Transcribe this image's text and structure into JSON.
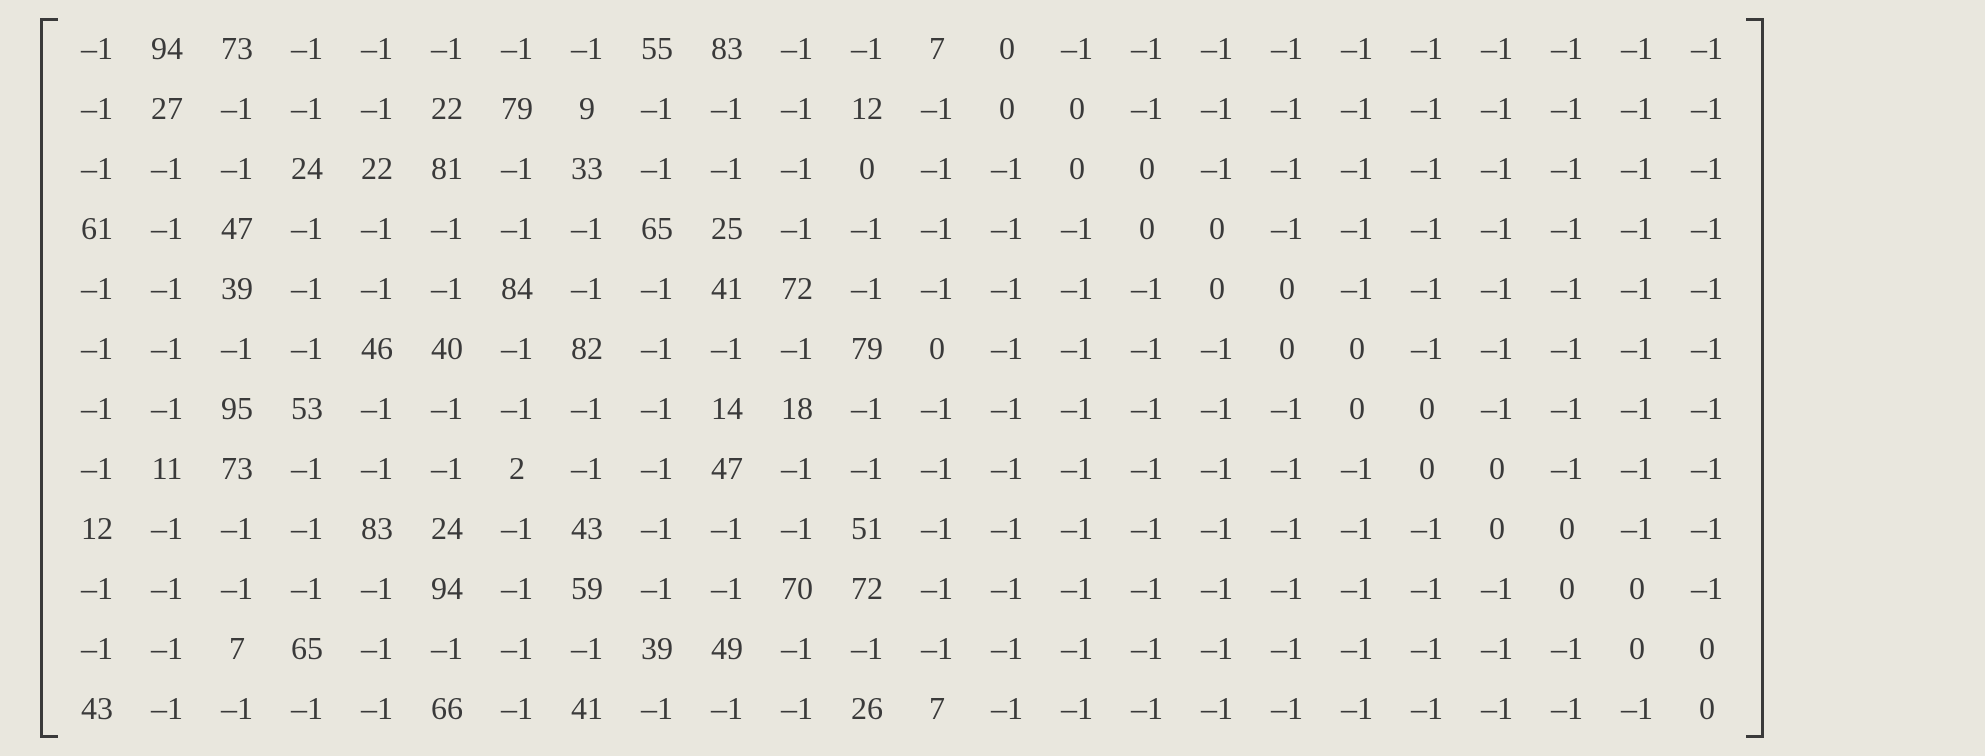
{
  "chart_data": {
    "type": "table",
    "title": "",
    "rows": 12,
    "cols": 24,
    "values": [
      [
        -1,
        94,
        73,
        -1,
        -1,
        -1,
        -1,
        -1,
        55,
        83,
        -1,
        -1,
        7,
        0,
        -1,
        -1,
        -1,
        -1,
        -1,
        -1,
        -1,
        -1,
        -1,
        -1
      ],
      [
        -1,
        27,
        -1,
        -1,
        -1,
        22,
        79,
        9,
        -1,
        -1,
        -1,
        12,
        -1,
        0,
        0,
        -1,
        -1,
        -1,
        -1,
        -1,
        -1,
        -1,
        -1,
        -1
      ],
      [
        -1,
        -1,
        -1,
        24,
        22,
        81,
        -1,
        33,
        -1,
        -1,
        -1,
        0,
        -1,
        -1,
        0,
        0,
        -1,
        -1,
        -1,
        -1,
        -1,
        -1,
        -1,
        -1
      ],
      [
        61,
        -1,
        47,
        -1,
        -1,
        -1,
        -1,
        -1,
        65,
        25,
        -1,
        -1,
        -1,
        -1,
        -1,
        0,
        0,
        -1,
        -1,
        -1,
        -1,
        -1,
        -1,
        -1
      ],
      [
        -1,
        -1,
        39,
        -1,
        -1,
        -1,
        84,
        -1,
        -1,
        41,
        72,
        -1,
        -1,
        -1,
        -1,
        -1,
        0,
        0,
        -1,
        -1,
        -1,
        -1,
        -1,
        -1
      ],
      [
        -1,
        -1,
        -1,
        -1,
        46,
        40,
        -1,
        82,
        -1,
        -1,
        -1,
        79,
        0,
        -1,
        -1,
        -1,
        -1,
        0,
        0,
        -1,
        -1,
        -1,
        -1,
        -1
      ],
      [
        -1,
        -1,
        95,
        53,
        -1,
        -1,
        -1,
        -1,
        -1,
        14,
        18,
        -1,
        -1,
        -1,
        -1,
        -1,
        -1,
        -1,
        0,
        0,
        -1,
        -1,
        -1,
        -1
      ],
      [
        -1,
        11,
        73,
        -1,
        -1,
        -1,
        2,
        -1,
        -1,
        47,
        -1,
        -1,
        -1,
        -1,
        -1,
        -1,
        -1,
        -1,
        -1,
        0,
        0,
        -1,
        -1,
        -1
      ],
      [
        12,
        -1,
        -1,
        -1,
        83,
        24,
        -1,
        43,
        -1,
        -1,
        -1,
        51,
        -1,
        -1,
        -1,
        -1,
        -1,
        -1,
        -1,
        -1,
        0,
        0,
        -1,
        -1
      ],
      [
        -1,
        -1,
        -1,
        -1,
        -1,
        94,
        -1,
        59,
        -1,
        -1,
        70,
        72,
        -1,
        -1,
        -1,
        -1,
        -1,
        -1,
        -1,
        -1,
        -1,
        0,
        0,
        -1
      ],
      [
        -1,
        -1,
        7,
        65,
        -1,
        -1,
        -1,
        -1,
        39,
        49,
        -1,
        -1,
        -1,
        -1,
        -1,
        -1,
        -1,
        -1,
        -1,
        -1,
        -1,
        -1,
        0,
        0
      ],
      [
        43,
        -1,
        -1,
        -1,
        -1,
        66,
        -1,
        41,
        -1,
        -1,
        -1,
        26,
        7,
        -1,
        -1,
        -1,
        -1,
        -1,
        -1,
        -1,
        -1,
        -1,
        -1,
        0
      ]
    ]
  },
  "minus_glyph": "–"
}
